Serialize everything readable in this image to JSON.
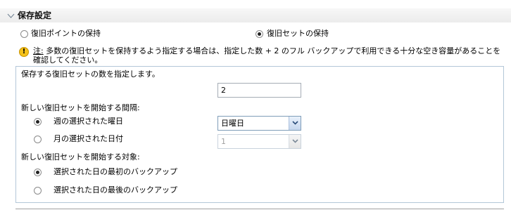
{
  "section": {
    "title": "保存設定"
  },
  "retention": {
    "options": [
      {
        "label": "復旧ポイントの保持",
        "selected": false
      },
      {
        "label": "復旧セットの保持",
        "selected": true
      }
    ]
  },
  "note": {
    "label": "注:",
    "text": " 多数の復旧セットを保持するよう指定する場合は、指定した数 + 2 のフル バックアップで利用できる十分な空き容量があることを確認してください。"
  },
  "recovery_sets": {
    "count_label": "保存する復旧セットの数を指定します。",
    "count_value": "2",
    "interval_label": "新しい復旧セットを開始する間隔:",
    "interval_options": [
      {
        "label": "週の選択された曜日",
        "selected": true,
        "combo_value": "日曜日",
        "enabled": true
      },
      {
        "label": "月の選択された日付",
        "selected": false,
        "combo_value": "1",
        "enabled": false
      }
    ],
    "target_label": "新しい復旧セットを開始する対象:",
    "target_options": [
      {
        "label": "選択された日の最初のバックアップ",
        "selected": true
      },
      {
        "label": "選択された日の最後のバックアップ",
        "selected": false
      }
    ]
  },
  "icons": {
    "collapse": "chevron-down-icon",
    "warning": "warning-icon",
    "dropdown": "dropdown-arrow-icon"
  },
  "colors": {
    "header_bg": "#ececec",
    "panel_border": "#b3c7d8",
    "warning": "#f5c21a",
    "combo_border": "#7f9db9"
  }
}
